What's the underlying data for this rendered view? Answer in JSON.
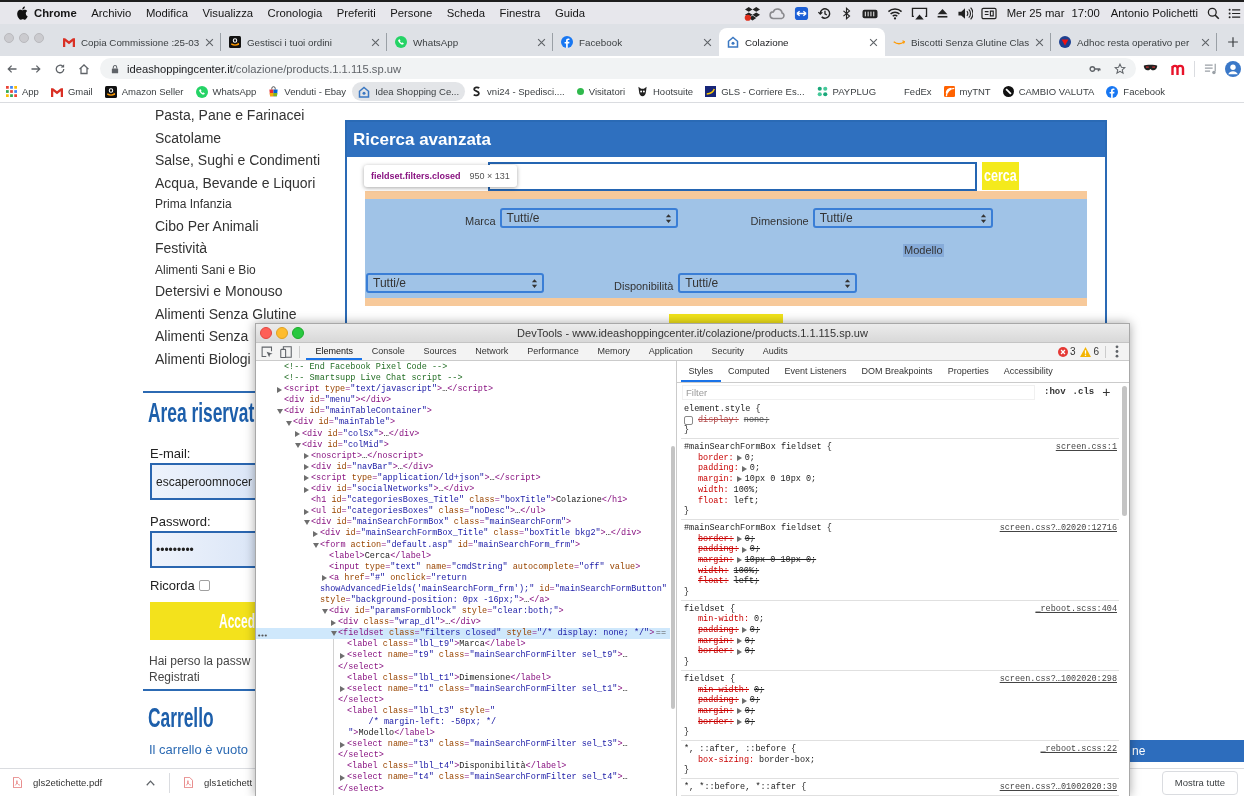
{
  "menu_bar": {
    "app_name": "Chrome",
    "menus": [
      "Archivio",
      "Modifica",
      "Visualizza",
      "Cronologia",
      "Preferiti",
      "Persone",
      "Scheda",
      "Finestra",
      "Guida"
    ],
    "date": "Mer 25 mar",
    "time": "17:00",
    "user": "Antonio Polichetti"
  },
  "tabs": [
    {
      "title": "Copia Commissione :25-03",
      "selected": false
    },
    {
      "title": "Gestisci i tuoi ordini",
      "selected": false
    },
    {
      "title": "WhatsApp",
      "selected": false
    },
    {
      "title": "Facebook",
      "selected": false
    },
    {
      "title": "Colazione",
      "selected": true
    },
    {
      "title": "Biscotti Senza Glutine Clas",
      "selected": false
    },
    {
      "title": "Adhoc resta operativo per",
      "selected": false
    }
  ],
  "address_bar": {
    "host": "ideashoppingcenter.it",
    "path": "/colazione/products.1.1.115.sp.uw"
  },
  "bookmarks": [
    {
      "label": "App",
      "highlighted": false
    },
    {
      "label": "Gmail",
      "highlighted": false
    },
    {
      "label": "Amazon Seller",
      "highlighted": false
    },
    {
      "label": "WhatsApp",
      "highlighted": false
    },
    {
      "label": "Venduti - Ebay",
      "highlighted": false
    },
    {
      "label": "Idea Shopping Ce...",
      "highlighted": true
    },
    {
      "label": "vni24 - Spedisci....",
      "highlighted": false
    },
    {
      "label": "Visitatori",
      "highlighted": false
    },
    {
      "label": "Hootsuite",
      "highlighted": false
    },
    {
      "label": "GLS - Corriere Es...",
      "highlighted": false
    },
    {
      "label": "PAYPLUG",
      "highlighted": false
    },
    {
      "label": "FedEx",
      "highlighted": false
    },
    {
      "label": "myTNT",
      "highlighted": false
    },
    {
      "label": "CAMBIO VALUTA",
      "highlighted": false
    },
    {
      "label": "Facebook",
      "highlighted": false
    }
  ],
  "page": {
    "categories": [
      {
        "label": "Pasta, Pane e Farinacei",
        "kind": "major"
      },
      {
        "label": "Scatolame",
        "kind": "major"
      },
      {
        "label": "Salse, Sughi e Condimenti",
        "kind": "major"
      },
      {
        "label": "Acqua, Bevande e Liquori",
        "kind": "major"
      },
      {
        "label": "Prima Infanzia",
        "kind": "minor"
      },
      {
        "label": "Cibo Per Animali",
        "kind": "major"
      },
      {
        "label": "Festività",
        "kind": "major"
      },
      {
        "label": "Alimenti Sani e Bio",
        "kind": "minor"
      },
      {
        "label": "Detersivi e Monouso",
        "kind": "major"
      },
      {
        "label": "Alimenti Senza Glutine",
        "kind": "major"
      },
      {
        "label": "Alimenti Senza",
        "kind": "major"
      },
      {
        "label": "Alimenti Biologi",
        "kind": "major"
      }
    ],
    "login": {
      "title": "Area riservat",
      "email_label": "E-mail:",
      "email_value": "escaperoomnocer",
      "password_label": "Password:",
      "password_value": "•••••••••",
      "remember_label": "Ricorda",
      "remember_checked": false,
      "submit_label": "Acced",
      "lost_password": "Hai perso la passw",
      "register": "Registrati"
    },
    "cart": {
      "title": "Carrello",
      "status": "Il carrello è vuoto"
    },
    "advanced_search": {
      "title": "Ricerca avanzata",
      "search_button": "cerca",
      "filters": [
        {
          "label": "Marca",
          "value": "Tutti/e",
          "highlighted": false
        },
        {
          "label": "Dimensione",
          "value": "Tutti/e",
          "highlighted": false
        },
        {
          "label": "Modello",
          "value": "Tutti/e",
          "highlighted": true
        },
        {
          "label": "Disponibilità",
          "value": "Tutti/e",
          "highlighted": false
        }
      ]
    },
    "inspect_tooltip": {
      "selector": "fieldset.filters.closed",
      "size": "950 × 131"
    },
    "chat_bar": {
      "label": "ne"
    }
  },
  "downloads": {
    "items": [
      {
        "name": "gls2etichette.pdf"
      },
      {
        "name": "gls1etichett"
      }
    ],
    "show_all": "Mostra tutte"
  },
  "devtools": {
    "title": "DevTools - www.ideashoppingcenter.it/colazione/products.1.1.115.sp.uw",
    "panels": [
      {
        "label": "Elements",
        "selected": true
      },
      {
        "label": "Console",
        "selected": false
      },
      {
        "label": "Sources",
        "selected": false
      },
      {
        "label": "Network",
        "selected": false
      },
      {
        "label": "Performance",
        "selected": false
      },
      {
        "label": "Memory",
        "selected": false
      },
      {
        "label": "Application",
        "selected": false
      },
      {
        "label": "Security",
        "selected": false
      },
      {
        "label": "Audits",
        "selected": false
      }
    ],
    "error_count": "3",
    "warning_count": "6",
    "dom_tree": [
      {
        "kind": "comment",
        "selected": false,
        "lines": [
          "<!-- End Facebook Pixel Code -->"
        ]
      },
      {
        "kind": "comment",
        "selected": false,
        "lines": [
          "<!-- Smartsupp Live Chat script -->"
        ]
      },
      {
        "kind": "element",
        "expanded": false,
        "selected": false,
        "lines": [
          "<script type=\"text/javascript\">…</script>"
        ]
      },
      {
        "kind": "leaf",
        "selected": false,
        "lines": [
          "<div id=\"menu\"></div>"
        ]
      },
      {
        "kind": "element",
        "expanded": true,
        "selected": false,
        "lines": [
          "<div id=\"mainTableContainer\">"
        ],
        "children": [
          {
            "kind": "element",
            "expanded": true,
            "selected": false,
            "lines": [
              "<div id=\"mainTable\">"
            ],
            "children": [
              {
                "kind": "element",
                "expanded": false,
                "selected": false,
                "lines": [
                  "<div id=\"colSx\">…</div>"
                ]
              },
              {
                "kind": "element",
                "expanded": true,
                "selected": false,
                "lines": [
                  "<div id=\"colMid\">"
                ],
                "children": [
                  {
                    "kind": "element",
                    "expanded": false,
                    "selected": false,
                    "lines": [
                      "<noscript>…</noscript>"
                    ]
                  },
                  {
                    "kind": "element",
                    "expanded": false,
                    "selected": false,
                    "lines": [
                      "<div id=\"navBar\">…</div>"
                    ]
                  },
                  {
                    "kind": "element",
                    "expanded": false,
                    "selected": false,
                    "lines": [
                      "<script type=\"application/ld+json\">…</script>"
                    ]
                  },
                  {
                    "kind": "element",
                    "expanded": false,
                    "selected": false,
                    "lines": [
                      "<div id=\"socialNetworks\">…</div>"
                    ]
                  },
                  {
                    "kind": "leaf",
                    "selected": false,
                    "lines": [
                      "<h1 id=\"categoriesBoxes_Title\" class=\"boxTitle\">Colazione</h1>"
                    ]
                  },
                  {
                    "kind": "element",
                    "expanded": false,
                    "selected": false,
                    "lines": [
                      "<ul id=\"categoriesBoxes\" class=\"noDesc\">…</ul>"
                    ]
                  },
                  {
                    "kind": "element",
                    "expanded": true,
                    "selected": false,
                    "lines": [
                      "<div id=\"mainSearchFormBox\" class=\"mainSearchForm\">"
                    ],
                    "children": [
                      {
                        "kind": "element",
                        "expanded": false,
                        "selected": false,
                        "lines": [
                          "<div id=\"mainSearchFormBox_Title\" class=\"boxTitle bkg2\">…</div>"
                        ]
                      },
                      {
                        "kind": "element",
                        "expanded": true,
                        "selected": false,
                        "lines": [
                          "<form action=\"default.asp\" id=\"mainSearchForm_frm\">"
                        ],
                        "children": [
                          {
                            "kind": "leaf",
                            "selected": false,
                            "lines": [
                              "<label>Cerca</label>"
                            ]
                          },
                          {
                            "kind": "leaf",
                            "selected": false,
                            "lines": [
                              "<input type=\"text\" name=\"cmdString\" autocomplete=\"off\" value>"
                            ]
                          },
                          {
                            "kind": "element",
                            "expanded": false,
                            "selected": false,
                            "lines": [
                              "<a href=\"#\" onclick=\"return",
                              "showAdvancedFields('mainSearchForm_frm');\" id=\"mainSearchFormButton\"",
                              "style=\"background-position: 0px -16px;\">…</a>"
                            ]
                          },
                          {
                            "kind": "element",
                            "expanded": true,
                            "selected": false,
                            "lines": [
                              "<div id=\"paramsFormblock\" style=\"clear:both;\">"
                            ],
                            "children": [
                              {
                                "kind": "element",
                                "expanded": false,
                                "selected": false,
                                "lines": [
                                  "<div class=\"wrap_dl\">…</div>"
                                ]
                              },
                              {
                                "kind": "element",
                                "expanded": true,
                                "selected": true,
                                "console_ref": "==",
                                "lines": [
                                  "<fieldset class=\"filters closed\" style=\"/* display: none; */\">"
                                ],
                                "children": [
                                  {
                                    "kind": "leaf",
                                    "selected": false,
                                    "lines": [
                                      "<label class=\"lbl_t9\">Marca</label>"
                                    ]
                                  },
                                  {
                                    "kind": "element",
                                    "expanded": false,
                                    "selected": false,
                                    "lines": [
                                      "<select name=\"t9\" class=\"mainSearchFormFilter sel_t9\">…",
                                      "</select>"
                                    ]
                                  },
                                  {
                                    "kind": "leaf",
                                    "selected": false,
                                    "lines": [
                                      "<label class=\"lbl_t1\">Dimensione</label>"
                                    ]
                                  },
                                  {
                                    "kind": "element",
                                    "expanded": false,
                                    "selected": false,
                                    "lines": [
                                      "<select name=\"t1\" class=\"mainSearchFormFilter sel_t1\">…",
                                      "</select>"
                                    ]
                                  },
                                  {
                                    "kind": "leaf",
                                    "selected": false,
                                    "lines": [
                                      "<label class=\"lbl_t3\" style=\"",
                                      "      /* margin-left: -50px; */",
                                      "  \">Modello</label>"
                                    ]
                                  },
                                  {
                                    "kind": "element",
                                    "expanded": false,
                                    "selected": false,
                                    "lines": [
                                      "<select name=\"t3\" class=\"mainSearchFormFilter sel_t3\">…",
                                      "</select>"
                                    ]
                                  },
                                  {
                                    "kind": "leaf",
                                    "selected": false,
                                    "lines": [
                                      "<label class=\"lbl_t4\">Disponibilità</label>"
                                    ]
                                  },
                                  {
                                    "kind": "element",
                                    "expanded": false,
                                    "selected": false,
                                    "lines": [
                                      "<select name=\"t4\" class=\"mainSearchFormFilter sel_t4\">…",
                                      "</select>"
                                    ]
                                  }
                                ]
                              }
                            ]
                          }
                        ]
                      }
                    ]
                  }
                ]
              }
            ]
          }
        ]
      }
    ],
    "sidebar_tabs": [
      {
        "label": "Styles",
        "selected": true
      },
      {
        "label": "Computed",
        "selected": false
      },
      {
        "label": "Event Listeners",
        "selected": false
      },
      {
        "label": "DOM Breakpoints",
        "selected": false
      },
      {
        "label": "Properties",
        "selected": false
      },
      {
        "label": "Accessibility",
        "selected": false
      }
    ],
    "filter": {
      "placeholder": "Filter"
    },
    "filter_buttons": [
      ":hov",
      ".cls",
      "+"
    ],
    "rules": [
      {
        "selector": "element.style {",
        "declarations": [
          {
            "property": "display:",
            "value": "none;",
            "enabled": false,
            "expandable": false
          }
        ],
        "close": "}"
      },
      {
        "selector": "#mainSearchFormBox fieldset {",
        "source": "screen.css:1",
        "declarations": [
          {
            "property": "border:",
            "value": "0;",
            "enabled": true,
            "overridden": false,
            "expandable": true
          },
          {
            "property": "padding:",
            "value": "0;",
            "enabled": true,
            "overridden": false,
            "expandable": true
          },
          {
            "property": "margin:",
            "value": "10px 0 10px 0;",
            "enabled": true,
            "overridden": false,
            "expandable": true
          },
          {
            "property": "width:",
            "value": "100%;",
            "enabled": true,
            "overridden": false,
            "expandable": false
          },
          {
            "property": "float:",
            "value": "left;",
            "enabled": true,
            "overridden": false,
            "expandable": false
          }
        ],
        "close": "}"
      },
      {
        "selector": "#mainSearchFormBox fieldset {",
        "source": "screen.css?…02020:12716",
        "declarations": [
          {
            "property": "border:",
            "value": "0;",
            "enabled": true,
            "overridden": true,
            "expandable": true
          },
          {
            "property": "padding:",
            "value": "0;",
            "enabled": true,
            "overridden": true,
            "expandable": true
          },
          {
            "property": "margin:",
            "value": "10px 0 10px 0;",
            "enabled": true,
            "overridden": true,
            "expandable": true
          },
          {
            "property": "width:",
            "value": "100%;",
            "enabled": true,
            "overridden": true,
            "expandable": false
          },
          {
            "property": "float:",
            "value": "left;",
            "enabled": true,
            "overridden": true,
            "expandable": false
          }
        ],
        "close": "}"
      },
      {
        "selector": "fieldset {",
        "source": "_reboot.scss:404",
        "declarations": [
          {
            "property": "min-width:",
            "value": "0;",
            "enabled": true,
            "overridden": false,
            "expandable": false
          },
          {
            "property": "padding:",
            "value": "0;",
            "enabled": true,
            "overridden": true,
            "expandable": true
          },
          {
            "property": "margin:",
            "value": "0;",
            "enabled": true,
            "overridden": true,
            "expandable": true
          },
          {
            "property": "border:",
            "value": "0;",
            "enabled": true,
            "overridden": true,
            "expandable": true
          }
        ],
        "close": "}"
      },
      {
        "selector": "fieldset {",
        "source": "screen.css?…1002020:298",
        "declarations": [
          {
            "property": "min-width:",
            "value": "0;",
            "enabled": true,
            "overridden": true,
            "expandable": false
          },
          {
            "property": "padding:",
            "value": "0;",
            "enabled": true,
            "overridden": true,
            "expandable": true
          },
          {
            "property": "margin:",
            "value": "0;",
            "enabled": true,
            "overridden": true,
            "expandable": true
          },
          {
            "property": "border:",
            "value": "0;",
            "enabled": true,
            "overridden": true,
            "expandable": true
          }
        ],
        "close": "}"
      },
      {
        "selector": "*, ::after, ::before {",
        "source": "_reboot.scss:22",
        "declarations": [
          {
            "property": "box-sizing:",
            "value": "border-box;",
            "enabled": true,
            "overridden": false,
            "expandable": false
          }
        ],
        "close": "}"
      },
      {
        "selector": "*, *::before, *::after {",
        "source": "screen.css?…01002020:39"
      }
    ]
  }
}
